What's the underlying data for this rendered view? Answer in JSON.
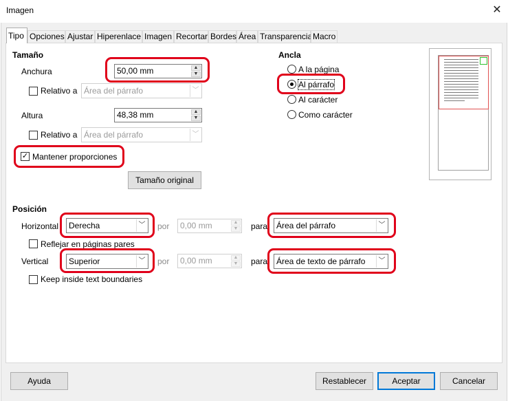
{
  "window": {
    "title": "Imagen",
    "close_glyph": "✕"
  },
  "tabs": [
    "Tipo",
    "Opciones",
    "Ajustar",
    "Hiperenlace",
    "Imagen",
    "Recortar",
    "Bordes",
    "Área",
    "Transparencia",
    "Macro"
  ],
  "size": {
    "heading": "Tamaño",
    "width_label": "Anchura",
    "width_value": "50,00 mm",
    "relative_label": "Relativo a",
    "relative_value": "Área del párrafo",
    "height_label": "Altura",
    "height_value": "48,38 mm",
    "relative2_label": "Relativo a",
    "relative2_value": "Área del párrafo",
    "keep_ratio_label": "Mantener proporciones",
    "keep_ratio_checked": true,
    "original_size_button": "Tamaño original"
  },
  "anchor": {
    "heading": "Ancla",
    "options": [
      "A la página",
      "Al párrafo",
      "Al carácter",
      "Como carácter"
    ],
    "selected": "Al párrafo"
  },
  "position": {
    "heading": "Posición",
    "horizontal_label": "Horizontal",
    "horizontal_value": "Derecha",
    "by_label": "por",
    "horizontal_by_value": "0,00 mm",
    "to_label": "para",
    "horizontal_to_value": "Área del párrafo",
    "mirror_label": "Reflejar en páginas pares",
    "vertical_label": "Vertical",
    "vertical_value": "Superior",
    "vertical_by_value": "0,00 mm",
    "vertical_to_value": "Área de texto de párrafo",
    "keep_inside_label": "Keep inside text boundaries"
  },
  "buttons": {
    "help": "Ayuda",
    "reset": "Restablecer",
    "ok": "Aceptar",
    "cancel": "Cancelar"
  },
  "icons": {
    "spin_up": "▲",
    "spin_down": "▼",
    "dropdown": "﹀",
    "check": "✓"
  }
}
